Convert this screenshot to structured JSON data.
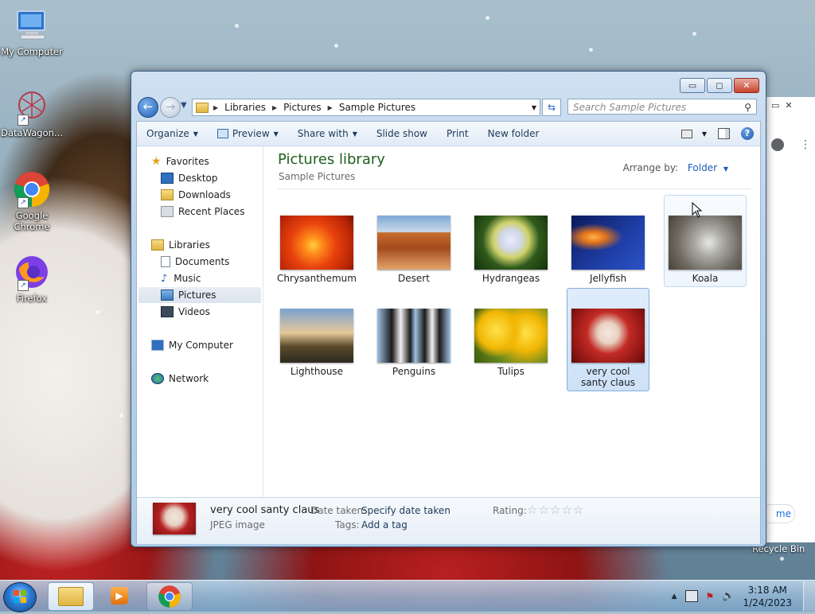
{
  "desktop": {
    "icons": [
      {
        "label": "My Computer",
        "icon": "computer-icon"
      },
      {
        "label": "DataWagon...",
        "icon": "datawagon-icon"
      },
      {
        "label": "Google Chrome",
        "icon": "chrome-icon"
      },
      {
        "label": "Firefox",
        "icon": "firefox-icon"
      }
    ],
    "recycle_bin_label": "Recycle Bin",
    "partial_chrome_text": "me"
  },
  "window": {
    "controls": {
      "minimize": "▭",
      "maximize": "◻",
      "close": "✕"
    },
    "address": {
      "crumbs": [
        "Libraries",
        "Pictures",
        "Sample Pictures"
      ],
      "separator": "▶"
    },
    "search": {
      "placeholder": "Search Sample Pictures"
    },
    "toolbar": {
      "organize": "Organize",
      "preview": "Preview",
      "share_with": "Share with",
      "slide_show": "Slide show",
      "print": "Print",
      "new_folder": "New folder"
    },
    "sidebar": {
      "favorites": "Favorites",
      "desktop": "Desktop",
      "downloads": "Downloads",
      "recent_places": "Recent Places",
      "libraries": "Libraries",
      "documents": "Documents",
      "music": "Music",
      "pictures": "Pictures",
      "videos": "Videos",
      "my_computer": "My Computer",
      "network": "Network"
    },
    "library": {
      "title": "Pictures library",
      "subtitle": "Sample Pictures",
      "arrange_label": "Arrange by:",
      "arrange_value": "Folder"
    },
    "files": [
      {
        "name": "Chrysanthemum",
        "state": "normal"
      },
      {
        "name": "Desert",
        "state": "normal"
      },
      {
        "name": "Hydrangeas",
        "state": "normal"
      },
      {
        "name": "Jellyfish",
        "state": "normal"
      },
      {
        "name": "Koala",
        "state": "hover"
      },
      {
        "name": "Lighthouse",
        "state": "normal"
      },
      {
        "name": "Penguins",
        "state": "normal"
      },
      {
        "name": "Tulips",
        "state": "normal"
      },
      {
        "name": "very cool santy claus",
        "state": "selected"
      }
    ],
    "details": {
      "name": "very cool santy claus",
      "type": "JPEG image",
      "date_label": "Date taken:",
      "date_value": "Specify date taken",
      "tags_label": "Tags:",
      "tags_value": "Add a tag",
      "rating_label": "Rating:",
      "rating_stars": "☆☆☆☆☆"
    }
  },
  "taskbar": {
    "time": "3:18 AM",
    "date": "1/24/2023"
  }
}
